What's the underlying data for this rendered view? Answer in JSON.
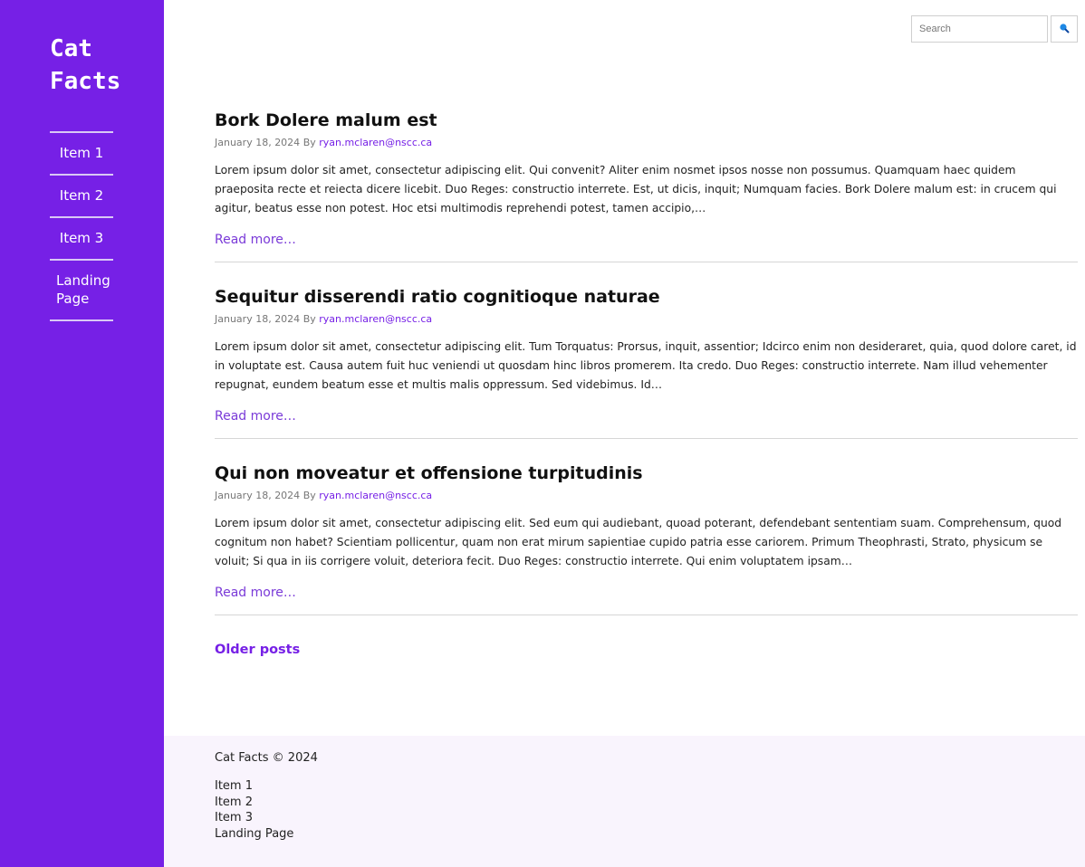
{
  "site": {
    "title_line1": "Cat",
    "title_line2": "Facts"
  },
  "nav": {
    "items": [
      {
        "label": "Item 1"
      },
      {
        "label": "Item 2"
      },
      {
        "label": "Item 3"
      },
      {
        "label": "Landing Page"
      }
    ]
  },
  "search": {
    "placeholder": "Search",
    "value": "",
    "button_icon": "search-icon"
  },
  "posts": [
    {
      "title": "Bork Dolere malum est",
      "date": "January 18, 2024",
      "by": "By",
      "author": "ryan.mclaren@nscc.ca",
      "excerpt": "Lorem ipsum dolor sit amet, consectetur adipiscing elit. Qui convenit? Aliter enim nosmet ipsos nosse non possumus. Quamquam haec quidem praeposita recte et reiecta dicere licebit. Duo Reges: constructio interrete. Est, ut dicis, inquit; Numquam facies. Bork Dolere malum est: in crucem qui agitur, beatus esse non potest. Hoc etsi multimodis reprehendi potest, tamen accipio,…",
      "read_more": "Read more…"
    },
    {
      "title": "Sequitur disserendi ratio cognitioque naturae",
      "date": "January 18, 2024",
      "by": "By",
      "author": "ryan.mclaren@nscc.ca",
      "excerpt": "Lorem ipsum dolor sit amet, consectetur adipiscing elit. Tum Torquatus: Prorsus, inquit, assentior; Idcirco enim non desideraret, quia, quod dolore caret, id in voluptate est. Causa autem fuit huc veniendi ut quosdam hinc libros promerem. Ita credo. Duo Reges: constructio interrete. Nam illud vehementer repugnat, eundem beatum esse et multis malis oppressum. Sed videbimus. Id…",
      "read_more": "Read more…"
    },
    {
      "title": "Qui non moveatur et offensione turpitudinis",
      "date": "January 18, 2024",
      "by": "By",
      "author": "ryan.mclaren@nscc.ca",
      "excerpt": "Lorem ipsum dolor sit amet, consectetur adipiscing elit. Sed eum qui audiebant, quoad poterant, defendebant sententiam suam. Comprehensum, quod cognitum non habet? Scientiam pollicentur, quam non erat mirum sapientiae cupido patria esse cariorem. Primum Theophrasti, Strato, physicum se voluit; Si qua in iis corrigere voluit, deteriora fecit. Duo Reges: constructio interrete. Qui enim voluptatem ipsam…",
      "read_more": "Read more…"
    }
  ],
  "pagination": {
    "older_label": "Older posts"
  },
  "footer": {
    "copyright": "Cat Facts © 2024",
    "links": [
      {
        "label": "Item 1"
      },
      {
        "label": "Item 2"
      },
      {
        "label": "Item 3"
      },
      {
        "label": "Landing Page"
      }
    ]
  },
  "colors": {
    "sidebar_bg": "#7620e6",
    "link": "#7620e6",
    "footer_bg": "#f9f4fd",
    "search_icon": "#1e88e5"
  }
}
